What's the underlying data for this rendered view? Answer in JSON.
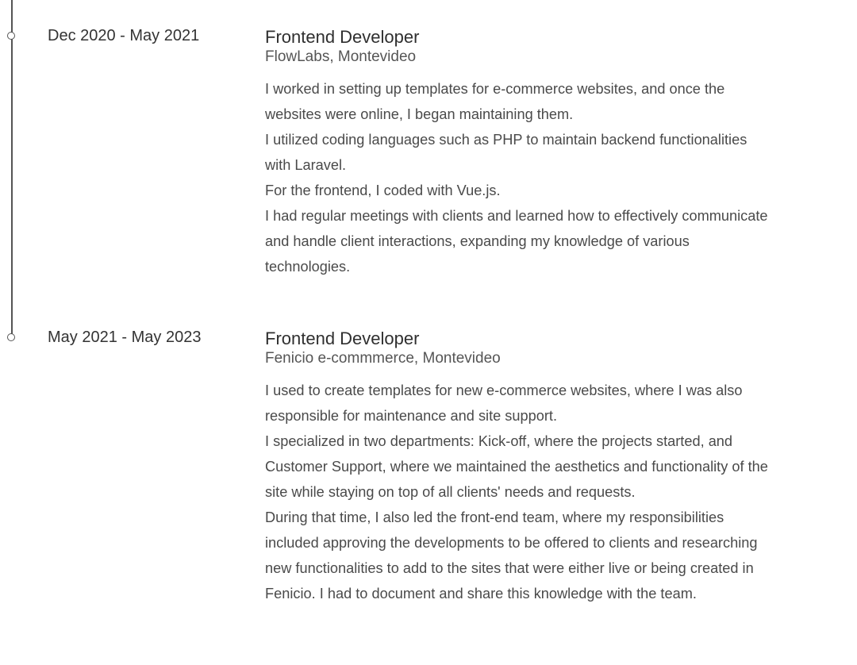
{
  "entries": [
    {
      "date": "Dec 2020 - May 2021",
      "role": "Frontend Developer",
      "company": "FlowLabs, Montevideo",
      "paragraphs": [
        "I worked in setting up templates for e-commerce websites, and once the websites were online, I began maintaining them.",
        "I utilized coding languages such as PHP to maintain backend functionalities with Laravel.",
        "For the frontend, I coded with Vue.js.",
        "I had regular meetings with clients and learned how to effectively communicate and handle client interactions, expanding my knowledge of various technologies."
      ]
    },
    {
      "date": "May 2021 - May 2023",
      "role": "Frontend Developer",
      "company": "Fenicio e-commmerce, Montevideo",
      "paragraphs": [
        "I used to create templates for new e-commerce websites, where I was also responsible for maintenance and site support.",
        "I specialized in two departments: Kick-off, where the projects started, and Customer Support, where we maintained the aesthetics and functionality of the site while staying on top of all clients' needs and requests.",
        "During that time, I also led the front-end team, where my responsibilities included approving the developments to be offered to clients and researching new functionalities to add to the sites that were either live or being created in Fenicio. I had to document and share this knowledge with the team."
      ]
    }
  ]
}
